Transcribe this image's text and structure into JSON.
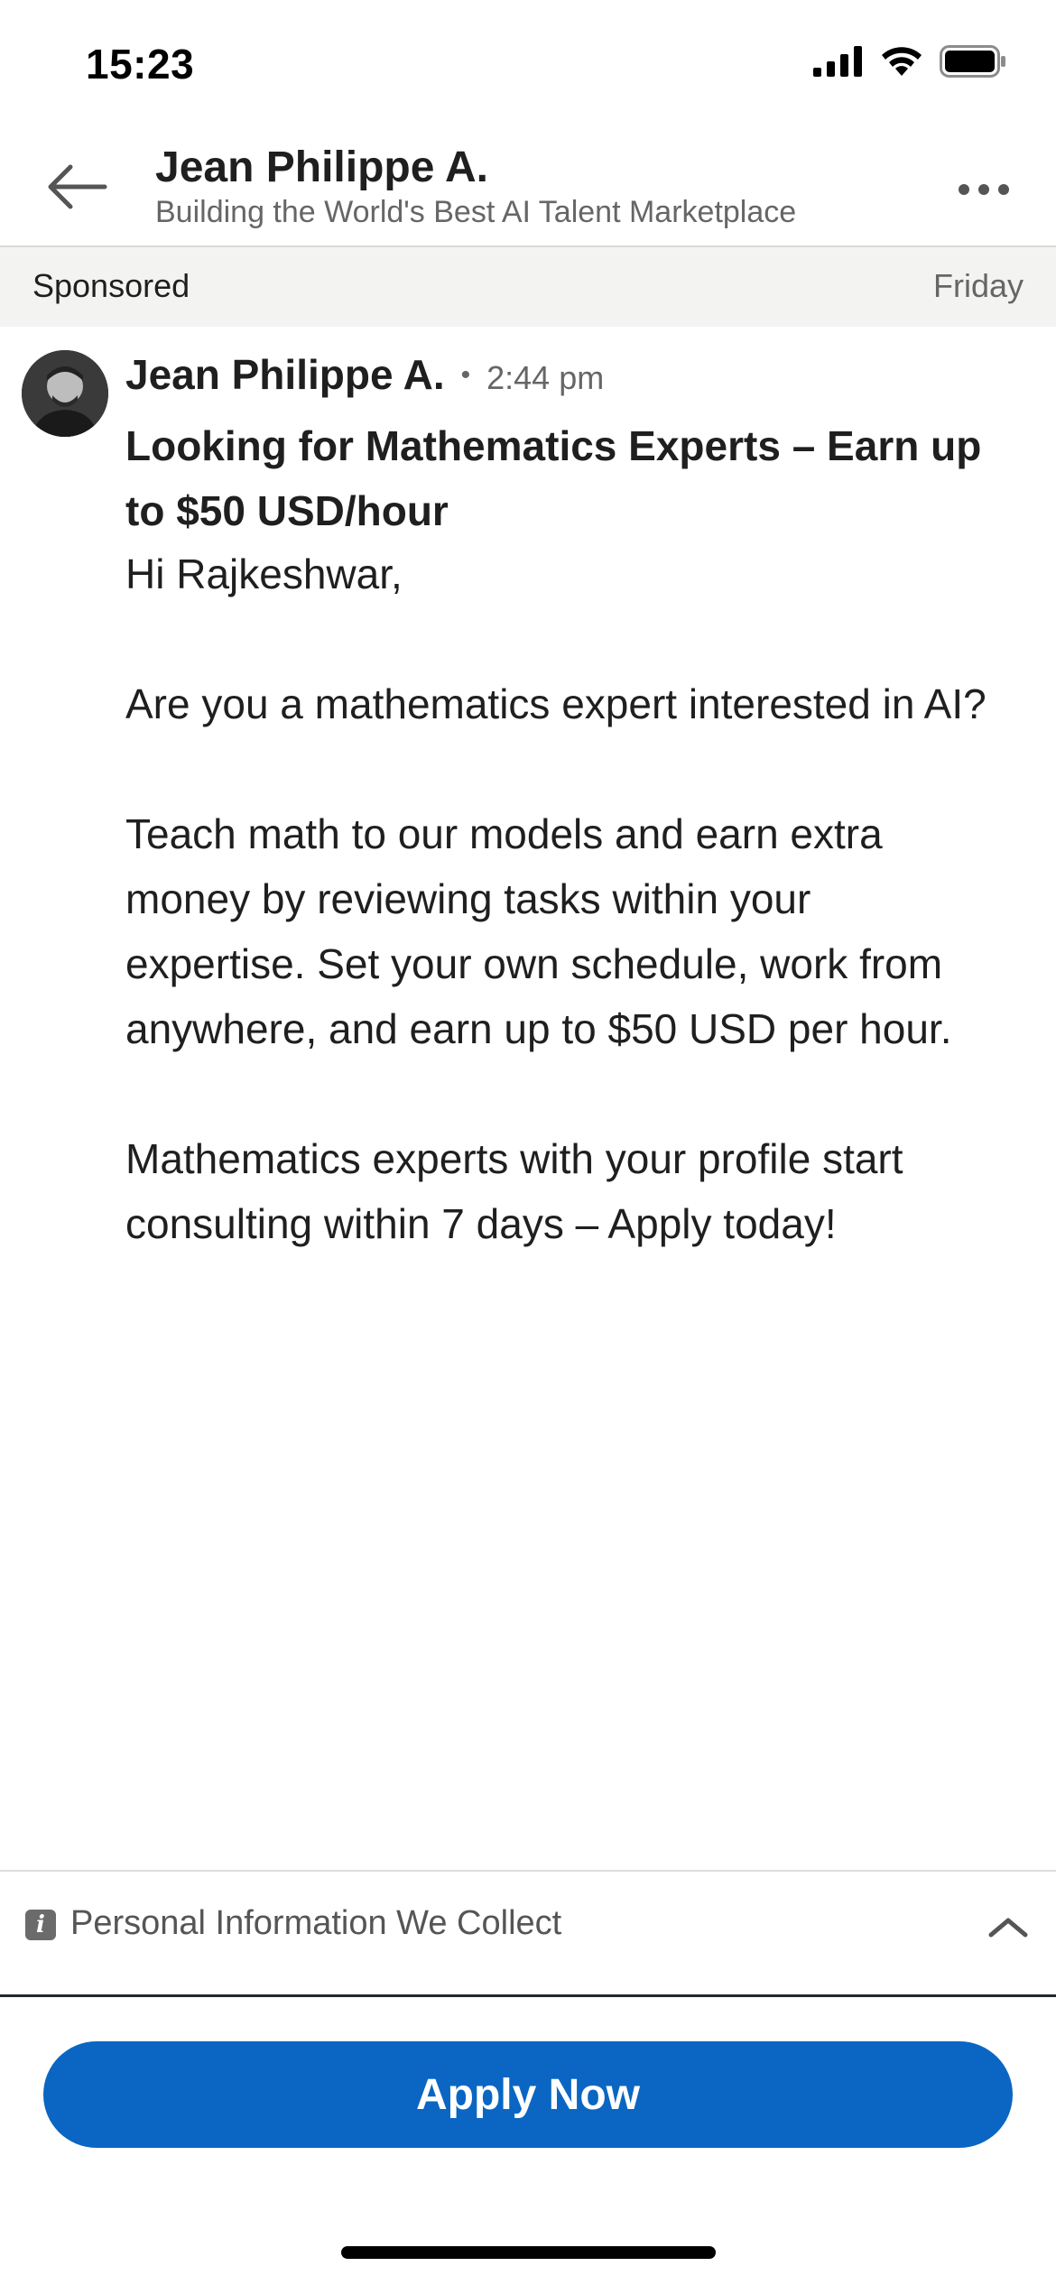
{
  "status_bar": {
    "time": "15:23",
    "icons": [
      "cellular-signal-icon",
      "wifi-icon",
      "battery-icon"
    ]
  },
  "header": {
    "back_icon": "arrow-left-icon",
    "name": "Jean Philippe A.",
    "subtitle": "Building the World's Best AI Talent Marketplace",
    "more_icon": "more-horizontal-icon"
  },
  "sponsored_bar": {
    "label": "Sponsored",
    "day": "Friday"
  },
  "message": {
    "sender": "Jean Philippe A.",
    "separator": "•",
    "time": "2:44 pm",
    "subject": "Looking for Mathematics Experts – Earn up to $50 USD/hour",
    "greeting": "Hi Rajkeshwar,",
    "paragraphs": [
      "Are you a mathematics expert interested in AI?",
      "Teach math to our models and earn extra money by reviewing tasks within your expertise. Set your own schedule, work from anywhere, and earn up to $50 USD per hour.",
      "Mathematics experts with your profile start consulting within 7 days – Apply today!"
    ]
  },
  "info_bar": {
    "icon": "info-icon",
    "icon_glyph": "i",
    "label": "Personal Information We Collect",
    "chevron_icon": "chevron-up-icon"
  },
  "cta": {
    "label": "Apply Now",
    "color": "#0a66c2"
  }
}
